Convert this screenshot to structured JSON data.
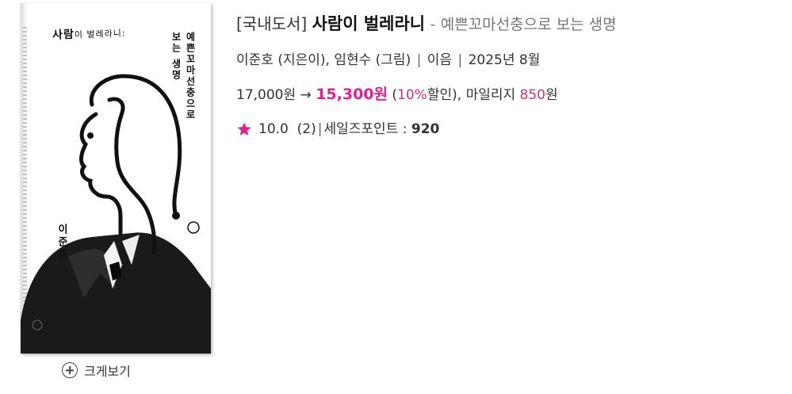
{
  "product": {
    "category": "[국내도서]",
    "title": "사람이 벌레라니",
    "subtitle_prefix": "-",
    "subtitle": "예쁜꼬마선충으로 보는 생명",
    "author": "이준호",
    "author_role": "(지은이),",
    "illustrator": "임현수",
    "illustrator_role": "(그림)",
    "publisher": "이음",
    "pub_date": "2025년 8월",
    "separator": "|",
    "list_price": "17,000원",
    "arrow": "→",
    "sale_price": "15,300원",
    "discount_open": "(",
    "discount_pct": "10%",
    "discount_close": "할인),",
    "mileage_label": "마일리지",
    "mileage_value": "850",
    "mileage_unit": "원",
    "rating_score": "10.0",
    "rating_count": "(2)",
    "points_label": "세일즈포인트 :",
    "points_value": "920"
  },
  "cover": {
    "title_main_1": "사람",
    "title_main_2": "이 벌레",
    "title_main_3": "라니:",
    "vertical_subtitle_1": "예쁜꼬마선충으로",
    "vertical_subtitle_2": "보는 생명",
    "author": "이준호"
  },
  "zoom": {
    "label": "크게보기",
    "icon": "plus-circle-icon"
  },
  "colors": {
    "accent": "#e0238a",
    "discount": "#c5377e",
    "star": "#e0238a",
    "text": "#333333"
  }
}
